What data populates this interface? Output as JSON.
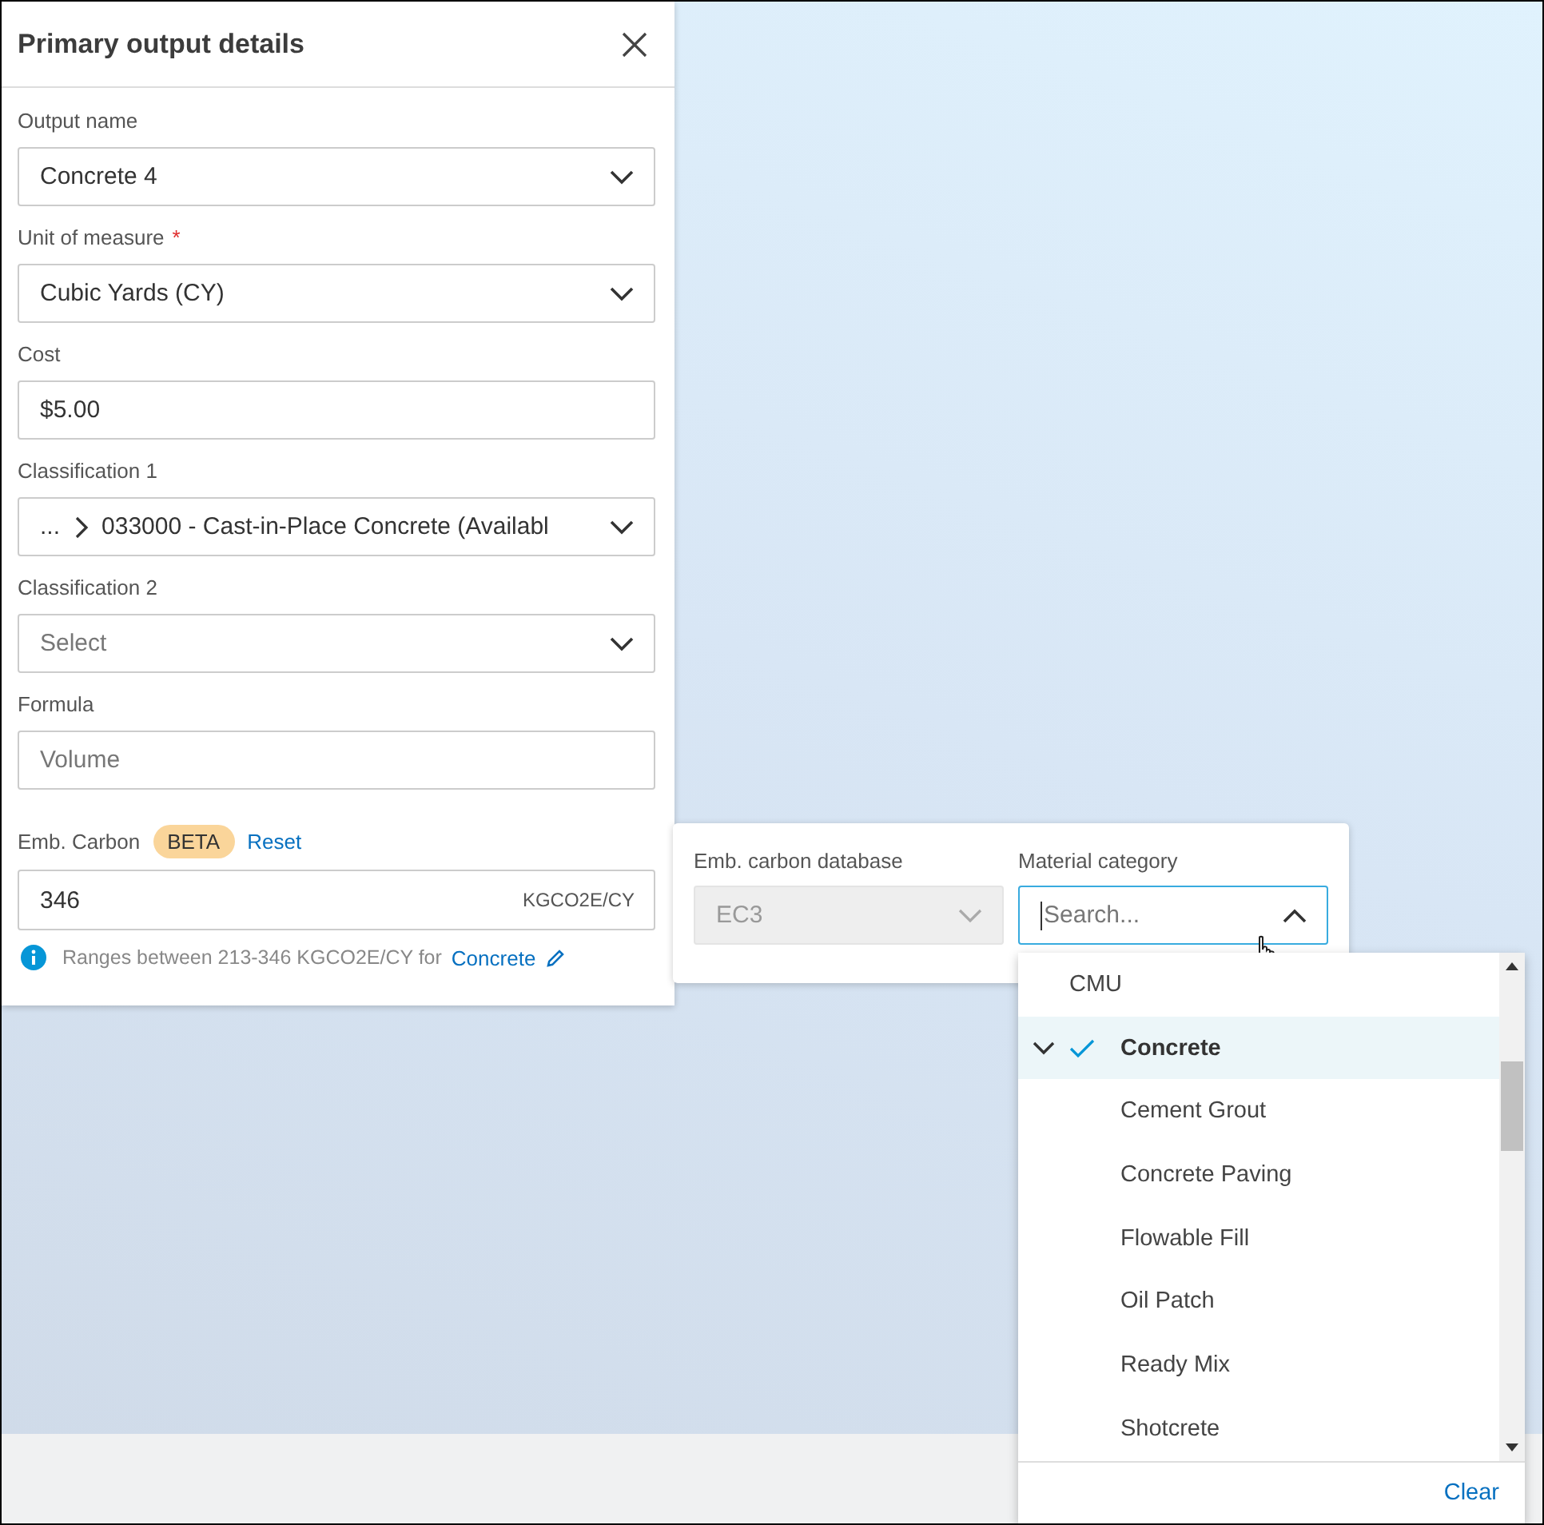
{
  "panel": {
    "title": "Primary output details",
    "fields": [
      {
        "kind": "select",
        "label": "Output name",
        "value": "Concrete 4"
      },
      {
        "kind": "select",
        "label": "Unit of measure",
        "required_mark": "*",
        "value": "Cubic Yards (CY)"
      },
      {
        "kind": "text",
        "label": "Cost",
        "value": "$5.00"
      },
      {
        "kind": "path-select",
        "label": "Classification 1",
        "prefix": "...",
        "value": "033000 - Cast-in-Place Concrete (Availabl"
      },
      {
        "kind": "select",
        "label": "Classification 2",
        "placeholder": "Select"
      },
      {
        "kind": "text",
        "label": "Formula",
        "placeholder": "Volume"
      }
    ],
    "emb_carbon": {
      "label": "Emb. Carbon",
      "badge": "BETA",
      "reset": "Reset",
      "value": "346",
      "unit": "KGCO2E/CY",
      "hint": "Ranges between 213-346 KGCO2E/CY for",
      "hint_link": "Concrete"
    }
  },
  "popover": {
    "database": {
      "label": "Emb. carbon database",
      "value": "EC3",
      "disabled": true
    },
    "category": {
      "label": "Material category",
      "placeholder": "Search...",
      "focused": true
    }
  },
  "dropdown": {
    "items": [
      {
        "label": "CMU",
        "selected": false
      },
      {
        "label": "Concrete",
        "selected": true,
        "expanded": true,
        "children": [
          {
            "label": "Cement Grout",
            "selected": false
          },
          {
            "label": "Concrete Paving",
            "selected": false
          },
          {
            "label": "Flowable Fill",
            "selected": false
          },
          {
            "label": "Oil Patch",
            "selected": false
          },
          {
            "label": "Ready Mix",
            "selected": false
          },
          {
            "label": "Shotcrete",
            "selected": false
          }
        ]
      }
    ],
    "clear": "Clear"
  }
}
